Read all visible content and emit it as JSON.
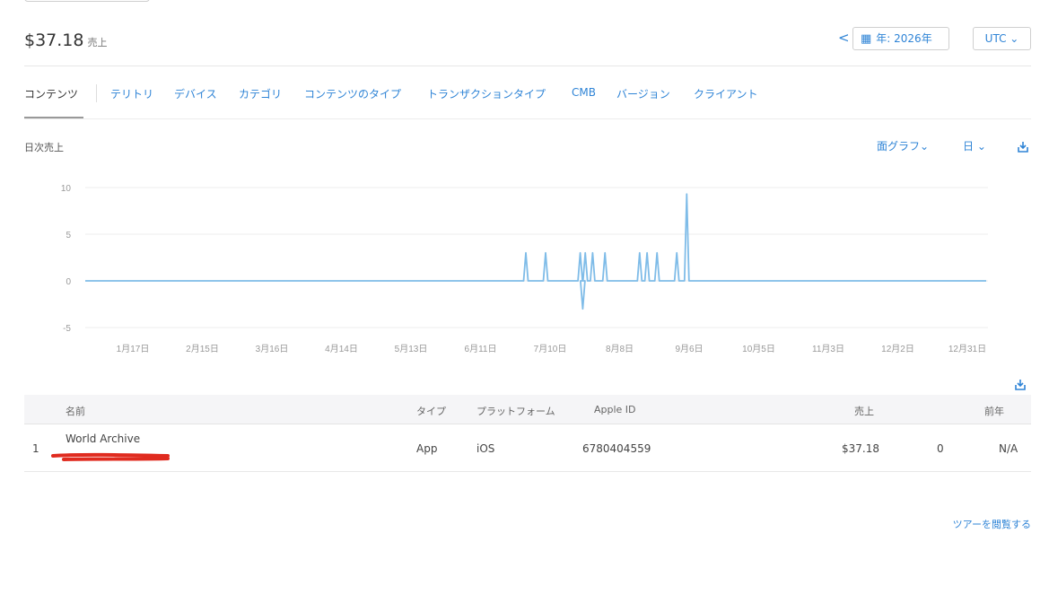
{
  "header": {
    "amount": "$37.18",
    "amount_suffix": "売上",
    "prev_label": "<",
    "calendar_icon": "calendar-icon",
    "year_label": "年: 2026年",
    "timezone_label": "UTC ⌄"
  },
  "tabs": [
    {
      "label": "コンテンツ",
      "active": true
    },
    {
      "label": "テリトリ"
    },
    {
      "label": "デバイス"
    },
    {
      "label": "カテゴリ"
    },
    {
      "label": "コンテンツのタイプ"
    },
    {
      "label": "トランザクションタイプ"
    },
    {
      "label": "CMB"
    },
    {
      "label": "バージョン"
    },
    {
      "label": "クライアント"
    }
  ],
  "section": {
    "title": "日次売上",
    "chart_type_label": "面グラフ⌄",
    "interval_label": "日 ⌄",
    "download_icon": "download-icon"
  },
  "chart_data": {
    "type": "line",
    "title": "",
    "xlabel": "",
    "ylabel": "",
    "ylim": [
      -5,
      10
    ],
    "yticks": [
      10,
      5,
      0,
      -5
    ],
    "xticks": [
      "1月17日",
      "2月15日",
      "3月16日",
      "4月14日",
      "5月13日",
      "6月11日",
      "7月10日",
      "8月8日",
      "9月6日",
      "10月5日",
      "11月3日",
      "12月2日",
      "12月31日"
    ],
    "x_range": [
      "2026-01-01",
      "2026-12-31"
    ],
    "grid": true,
    "color": "#7fbce8",
    "series": [
      {
        "x": [
          "2026-01-01",
          "2026-06-28",
          "2026-07-06",
          "2026-07-20",
          "2026-07-21",
          "2026-07-22",
          "2026-07-25",
          "2026-07-30",
          "2026-08-13",
          "2026-08-16",
          "2026-08-20",
          "2026-08-28",
          "2026-09-01",
          "2026-12-31"
        ],
        "y": [
          0,
          3,
          3,
          3,
          -3,
          3,
          3,
          3,
          3,
          3,
          3,
          3,
          9.3,
          0
        ]
      }
    ]
  },
  "table": {
    "download_icon": "download-icon",
    "headers": {
      "name": "名前",
      "type": "タイプ",
      "platform": "プラットフォーム",
      "apple_id": "Apple ID",
      "sales": "売上",
      "prev_year": "前年"
    },
    "rows": [
      {
        "rank": "1",
        "name": "World Archive",
        "type": "App",
        "platform": "iOS",
        "apple_id": "6780404559",
        "sales": "$37.18",
        "count": "0",
        "prev_year": "N/A"
      }
    ]
  },
  "footer": {
    "tour_link": "ツアーを閲覧する"
  }
}
